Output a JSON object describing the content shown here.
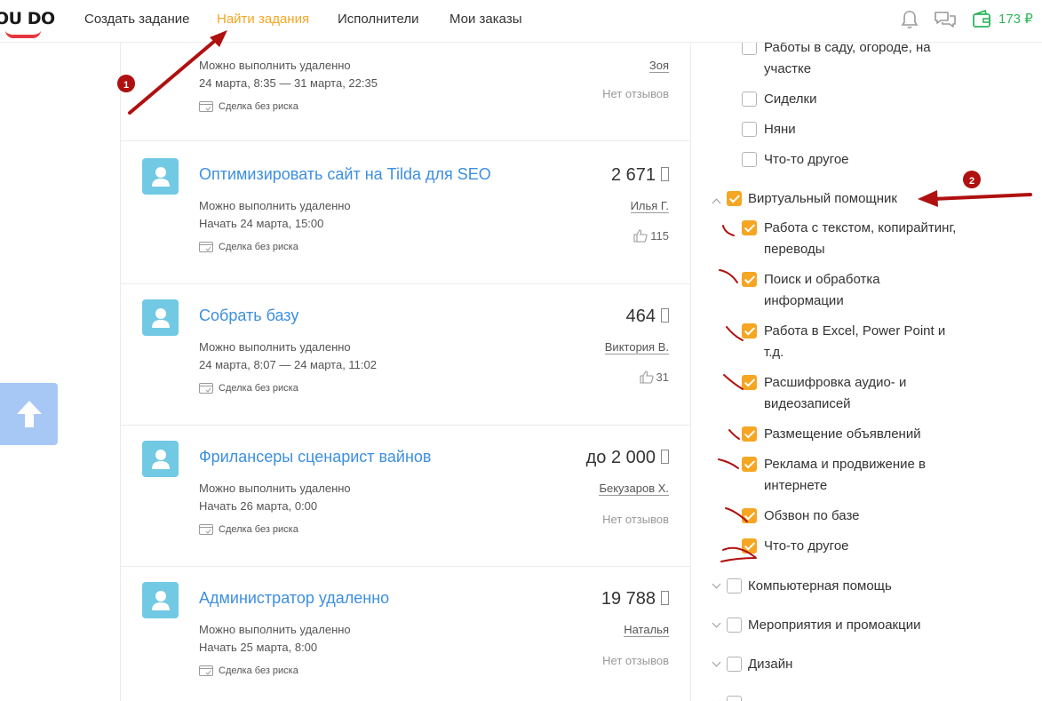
{
  "header": {
    "logo": "OU DO",
    "nav": [
      "Создать задание",
      "Найти задания",
      "Исполнители",
      "Мои заказы"
    ],
    "active_nav": "Найти задания",
    "icons": [
      "bell-icon",
      "chat-icon",
      "wallet-icon"
    ],
    "wallet_amount": "173 ₽",
    "accent": "#f5a623",
    "wallet_color": "#2fb55d"
  },
  "tasks": [
    {
      "title": "",
      "price": "",
      "remote": "Можно выполнить удаленно",
      "date": "24 марта, 8:35 — 31 марта, 22:35",
      "deal": "Сделка без риска",
      "author": "Зоя",
      "reviews": "Нет отзывов"
    },
    {
      "title": "Оптимизировать сайт на Tilda для SEO",
      "price": "2 671",
      "remote": "Можно выполнить удаленно",
      "date": "Начать 24 марта, 15:00",
      "deal": "Сделка без риска",
      "author": "Илья Г.",
      "likes": "115"
    },
    {
      "title": "Собрать базу",
      "price": "464",
      "remote": "Можно выполнить удаленно",
      "date": "24 марта, 8:07 — 24 марта, 11:02",
      "deal": "Сделка без риска",
      "author": "Виктория В.",
      "likes": "31"
    },
    {
      "title": "Фрилансеры сценарист вайнов",
      "price": "до 2 000",
      "remote": "Можно выполнить удаленно",
      "date": "Начать 26 марта, 0:00",
      "deal": "Сделка без риска",
      "author": "Бекузаров Х.",
      "reviews": "Нет отзывов"
    },
    {
      "title": "Администратор удаленно",
      "price": "19 788",
      "remote": "Можно выполнить удаленно",
      "date": "Начать 25 марта, 8:00",
      "deal": "Сделка без риска",
      "author": "Наталья",
      "reviews": "Нет отзывов"
    }
  ],
  "filters": {
    "prev_subitems": [
      {
        "label": "Работы в саду, огороде, на участке",
        "checked": false
      },
      {
        "label": "Сиделки",
        "checked": false
      },
      {
        "label": "Няни",
        "checked": false
      },
      {
        "label": "Что-то другое",
        "checked": false
      }
    ],
    "virtual_assistant": {
      "label": "Виртуальный помощник",
      "checked": true,
      "expanded": true,
      "subitems": [
        {
          "label": "Работа с текстом, копирайтинг, переводы",
          "checked": true
        },
        {
          "label": "Поиск и обработка информации",
          "checked": true
        },
        {
          "label": "Работа в Excel, Power Point и т.д.",
          "checked": true
        },
        {
          "label": "Расшифровка аудио- и видеозаписей",
          "checked": true
        },
        {
          "label": "Размещение объявлений",
          "checked": true
        },
        {
          "label": "Реклама и продвижение в интернете",
          "checked": true
        },
        {
          "label": "Обзвон по базе",
          "checked": true
        },
        {
          "label": "Что-то другое",
          "checked": true
        }
      ]
    },
    "categories": [
      {
        "label": "Компьютерная помощь",
        "checked": false
      },
      {
        "label": "Мероприятия и промоакции",
        "checked": false
      },
      {
        "label": "Дизайн",
        "checked": false
      }
    ]
  },
  "annotations": {
    "markers": [
      "1",
      "2"
    ],
    "color": "#b01010"
  }
}
